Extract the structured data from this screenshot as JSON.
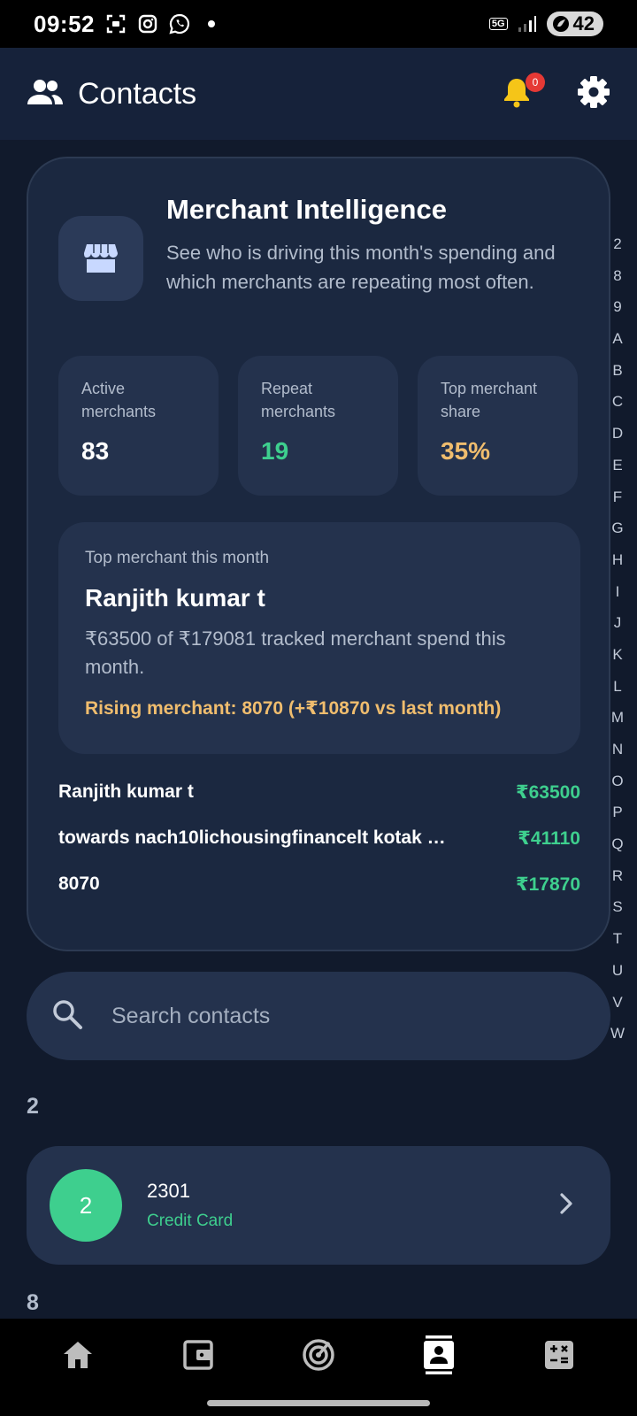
{
  "status_bar": {
    "time": "09:52",
    "network": "5G",
    "battery": "42",
    "icons": [
      "screenshot-icon",
      "instagram-icon",
      "whatsapp-icon",
      "dot-icon",
      "signal-icon"
    ]
  },
  "header": {
    "title": "Contacts",
    "notification_count": "0",
    "icons": [
      "contacts-icon",
      "bell-icon",
      "gear-icon"
    ]
  },
  "merchant_card": {
    "title": "Merchant Intelligence",
    "description": "See who is driving this month's spending and which merchants are repeating most often.",
    "icon": "store-icon",
    "stats": [
      {
        "label": "Active merchants",
        "value": "83",
        "color": "#ffffff"
      },
      {
        "label": "Repeat merchants",
        "value": "19",
        "color": "#3ecf8e"
      },
      {
        "label": "Top merchant share",
        "value": "35%",
        "color": "#f0bd6e"
      }
    ],
    "top_merchant": {
      "caption": "Top merchant this month",
      "name": "Ranjith kumar t",
      "description": "₹63500 of ₹179081 tracked merchant spend this month.",
      "rising": "Rising merchant: 8070 (+₹10870 vs last month)",
      "rising_color": "#f0bd6e"
    },
    "list": [
      {
        "name": "Ranjith kumar t",
        "amount": "₹63500"
      },
      {
        "name": "towards nach10lichousingfinancelt kotak …",
        "amount": "₹41110"
      },
      {
        "name": "8070",
        "amount": "₹17870"
      }
    ],
    "amount_color": "#3ecf8e"
  },
  "alphabet_index": [
    "2",
    "8",
    "9",
    "A",
    "B",
    "C",
    "D",
    "E",
    "F",
    "G",
    "H",
    "I",
    "J",
    "K",
    "L",
    "M",
    "N",
    "O",
    "P",
    "Q",
    "R",
    "S",
    "T",
    "U",
    "V",
    "W"
  ],
  "search": {
    "placeholder": "Search contacts",
    "value": ""
  },
  "sections": [
    {
      "letter": "2",
      "contacts": [
        {
          "avatar": "2",
          "name": "2301",
          "type": "Credit Card"
        }
      ]
    },
    {
      "letter": "8",
      "contacts": []
    }
  ],
  "bottom_nav": {
    "items": [
      "home-icon",
      "wallet-icon",
      "radar-icon",
      "contacts-book-icon",
      "calculator-icon"
    ],
    "active": "contacts-book-icon"
  }
}
